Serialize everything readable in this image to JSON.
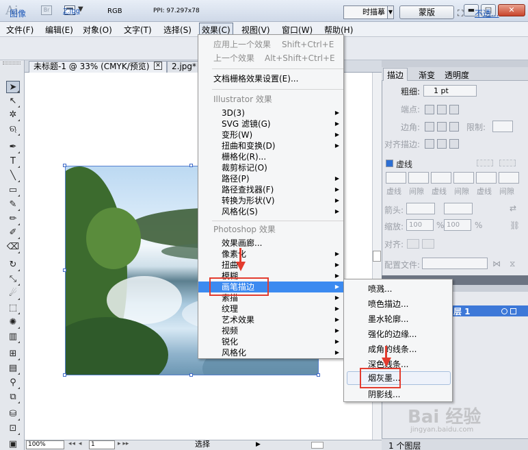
{
  "titlebar": {
    "app_logo": "Ai",
    "bridge_badge": "Br",
    "min_icon": "minimize-icon",
    "max_icon": "maximize-icon",
    "close_icon": "close-icon"
  },
  "menubar": {
    "items": [
      {
        "label": "文件(F)"
      },
      {
        "label": "编辑(E)"
      },
      {
        "label": "对象(O)"
      },
      {
        "label": "文字(T)"
      },
      {
        "label": "选择(S)"
      },
      {
        "label": "效果(C)"
      },
      {
        "label": "视图(V)"
      },
      {
        "label": "窗口(W)"
      },
      {
        "label": "帮助(H)"
      }
    ]
  },
  "controlbar": {
    "type_label": "图像",
    "file_link": "2.jpg",
    "color_mode": "RGB",
    "ppi": "PPI: 97.297x78",
    "trace_button": "时描摹",
    "mask_button": "蒙版",
    "opacity_link": "不透..."
  },
  "document": {
    "tab1_title": "未标题-1 @ 33% (CMYK/预览)",
    "tab2_title": "2.jpg*",
    "zoom": "100%",
    "page": "1",
    "status": "选择"
  },
  "effects_menu": {
    "apply_last": "应用上一个效果",
    "apply_last_shortcut": "Shift+Ctrl+E",
    "last_effect": "上一个效果",
    "last_effect_shortcut": "Alt+Shift+Ctrl+E",
    "raster_settings": "文档栅格效果设置(E)...",
    "illustrator_header": "Illustrator 效果",
    "illustrator_items": [
      "3D(3)",
      "SVG 滤镜(G)",
      "变形(W)",
      "扭曲和变换(D)",
      "栅格化(R)...",
      "裁剪标记(O)",
      "路径(P)",
      "路径查找器(F)",
      "转换为形状(V)",
      "风格化(S)"
    ],
    "photoshop_header": "Photoshop 效果",
    "photoshop_items": [
      "效果画廊...",
      "像素化",
      "扭曲",
      "模糊",
      "画笔描边",
      "素描",
      "纹理",
      "艺术效果",
      "视频",
      "锐化",
      "风格化"
    ]
  },
  "submenu": {
    "items": [
      "喷溅...",
      "喷色描边...",
      "墨水轮廓...",
      "强化的边缘...",
      "成角的线条...",
      "深色线条...",
      "烟灰墨...",
      "阴影线..."
    ]
  },
  "stroke_panel": {
    "tabs": [
      "描边",
      "渐变",
      "透明度"
    ],
    "weight_label": "粗细:",
    "weight_value": "1 pt",
    "cap_label": "端点:",
    "corner_label": "边角:",
    "limit_label": "限制:",
    "align_label": "对齐描边:",
    "dashed_label": "虚线",
    "dash_labels": [
      "虚线",
      "间隙",
      "虚线",
      "间隙",
      "虚线",
      "间隙"
    ],
    "arrow_label": "箭头:",
    "scale_label": "缩放:",
    "scale_value1": "100",
    "scale_value2": "100",
    "percent": "%",
    "align2_label": "对齐:",
    "profile_label": "配置文件:"
  },
  "layers_panel": {
    "layer_name": "层 1",
    "count": "1 个图层"
  },
  "watermark": {
    "text": "Bai 经验",
    "url": "jingyan.baidu.com"
  },
  "colors": {
    "highlight": "#3c8af0",
    "annotation_red": "#e33b2e",
    "link_blue": "#1a56b8"
  }
}
